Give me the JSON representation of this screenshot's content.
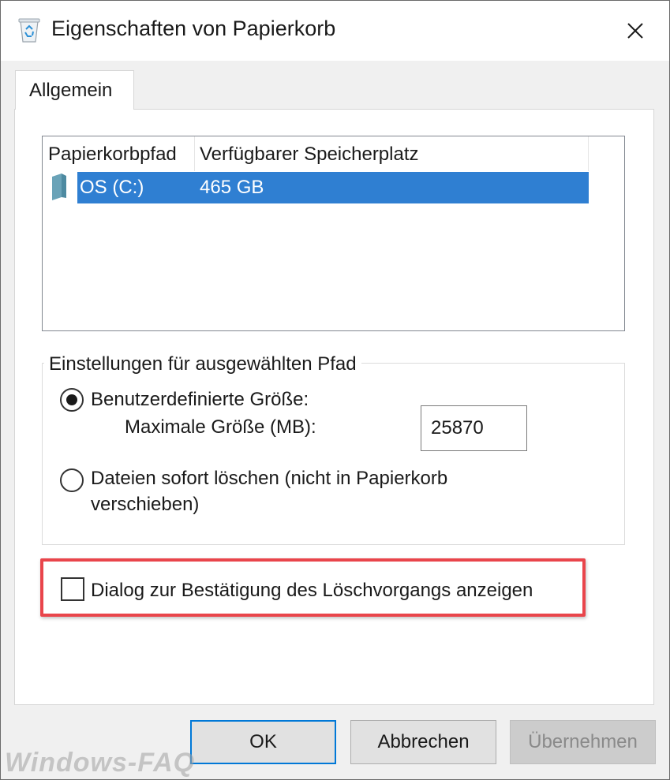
{
  "window": {
    "title": "Eigenschaften von Papierkorb",
    "close_icon": "close-icon",
    "app_icon": "recycle-bin-icon"
  },
  "tabs": [
    {
      "label": "Allgemein",
      "active": true
    }
  ],
  "list": {
    "columns": [
      "Papierkorbpfad",
      "Verfügbarer Speicherplatz"
    ],
    "rows": [
      {
        "path": "OS (C:)",
        "space": "465 GB",
        "selected": true,
        "icon": "drive-icon"
      }
    ]
  },
  "settings": {
    "legend": "Einstellungen für ausgewählten Pfad",
    "custom_size": {
      "label": "Benutzerdefinierte Größe:",
      "checked": true
    },
    "max_size": {
      "label": "Maximale Größe (MB):",
      "value": "25870"
    },
    "delete_immediately": {
      "label_line1": "Dateien sofort löschen (nicht in Papierkorb",
      "label_line2": "verschieben)",
      "checked": false
    }
  },
  "confirm_dialog": {
    "label": "Dialog zur Bestätigung des Löschvorgangs anzeigen",
    "checked": false
  },
  "buttons": {
    "ok": "OK",
    "cancel": "Abbrechen",
    "apply": "Übernehmen"
  },
  "watermark": "Windows-FAQ",
  "colors": {
    "selection": "#2f7fd2",
    "highlight": "#e9454b",
    "default_button_border": "#0078d7"
  }
}
